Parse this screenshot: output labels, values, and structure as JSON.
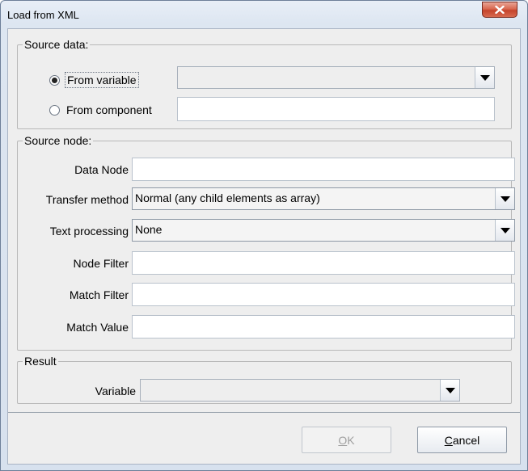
{
  "window": {
    "title": "Load from XML",
    "close_glyph": "x"
  },
  "source_data": {
    "legend": "Source data:",
    "from_variable": {
      "label": "From variable",
      "selected": true,
      "value": ""
    },
    "from_component": {
      "label": "From component",
      "selected": false,
      "value": ""
    }
  },
  "source_node": {
    "legend": "Source node:",
    "data_node": {
      "label": "Data Node",
      "value": ""
    },
    "transfer_method": {
      "label": "Transfer method",
      "value": "Normal (any child elements as array)"
    },
    "text_processing": {
      "label": "Text processing",
      "value": "None"
    },
    "node_filter": {
      "label": "Node Filter",
      "value": ""
    },
    "match_filter": {
      "label": "Match Filter",
      "value": ""
    },
    "match_value": {
      "label": "Match Value",
      "value": ""
    }
  },
  "result": {
    "legend": "Result",
    "variable": {
      "label": "Variable",
      "value": ""
    }
  },
  "buttons": {
    "ok": {
      "mnemonic": "O",
      "rest": "K",
      "enabled": false
    },
    "cancel": {
      "mnemonic": "C",
      "rest": "ancel",
      "enabled": true
    }
  },
  "icons": {
    "close": "close-icon",
    "dropdown": "chevron-down-icon",
    "radio": "radio-icon"
  },
  "colors": {
    "close_button": "#c5432b",
    "title_gradient": "#dde6f1",
    "dialog_bg": "#eeeeee"
  }
}
